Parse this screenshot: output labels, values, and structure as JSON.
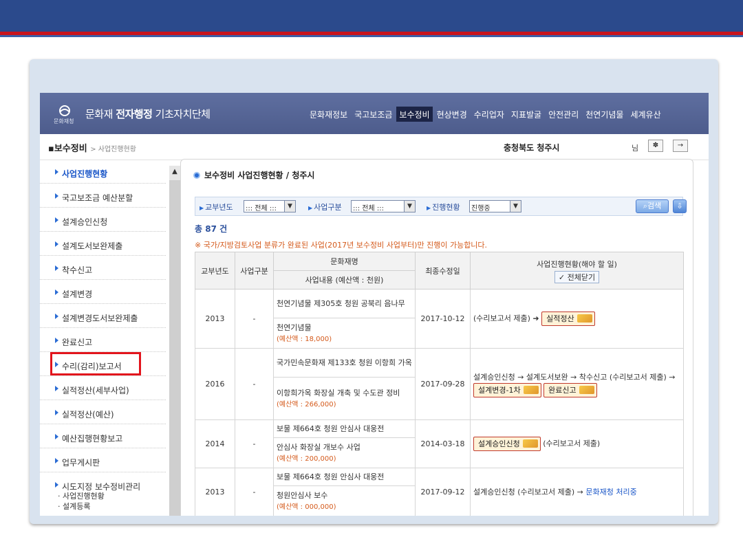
{
  "header": {
    "logo_text": "문화재청",
    "brand_prefix": "문화재",
    "brand_bold": "전자행정",
    "brand_suffix": "기초자치단체",
    "nav": [
      "문화재정보",
      "국고보조금",
      "보수정비",
      "현상변경",
      "수리업자",
      "지표발굴",
      "안전관리",
      "천연기념물",
      "세계유산"
    ],
    "active_nav": "보수정비"
  },
  "location": {
    "title": "보수정비",
    "sub": "> 사업진행현황",
    "org": "충청북도 청주시",
    "user_suffix": "님",
    "settings_icon": "gear-icon",
    "logout_icon": "logout-icon"
  },
  "sidebar": {
    "items": [
      "사업진행현황",
      "국고보조금 예산분할",
      "설계승인신청",
      "설계도서보완제출",
      "착수신고",
      "설계변경",
      "설계변경도서보완제출",
      "완료신고",
      "수리(감리)보고서",
      "실적정산(세부사업)",
      "실적정산(예산)",
      "예산집행현황보고",
      "업무게시판",
      "시도지정 보수정비관리"
    ],
    "sub_items": [
      "· 사업진행현황",
      "· 설계등록"
    ],
    "highlighted": "수리(감리)보고서"
  },
  "content": {
    "title": "보수정비 사업진행현황 / 청주시",
    "filters": {
      "year_label": "교부년도",
      "year_value": "::: 전체 :::",
      "type_label": "사업구분",
      "type_value": "::: 전체 :::",
      "status_label": "진행현황",
      "status_value": "진행중",
      "search_label": "검색"
    },
    "count": "총 87 건",
    "notice": "※ 국가/지방검토사업 분류가 완료된 사업(2017년 보수정비 사업부터)만 진행이 가능합니다.",
    "columns": {
      "year": "교부년도",
      "type": "사업구분",
      "name": "문화재명",
      "content": "사업내용 (예산액 : 천원)",
      "modified": "최종수정일",
      "progress": "사업진행현황(해야 할 일)",
      "close_all": "전체닫기"
    },
    "rows": [
      {
        "year": "2013",
        "type": "-",
        "name": "천연기념물 제305호 청원 공북리 음나무",
        "content": "천연기념물",
        "budget": "(예산액 : 18,000)",
        "modified": "2017-10-12",
        "progress_text": "(수리보고서 제출)",
        "buttons": [
          "실적정산"
        ]
      },
      {
        "year": "2016",
        "type": "-",
        "name": "국가민속문화재 제133호 청원 이항희 가옥",
        "content": "이항희가옥 화장실 개축 및 수도관 정비",
        "budget": "(예산액 : 266,000)",
        "modified": "2017-09-28",
        "progress_text": "설계승인신청 → 설계도서보완 → 착수신고 (수리보고서 제출) →",
        "buttons": [
          "설계변경-1차",
          "완료신고"
        ]
      },
      {
        "year": "2014",
        "type": "-",
        "name": "보물 제664호 청원 안심사 대웅전",
        "content": "안심사 화장실 개보수 사업",
        "budget": "(예산액 : 200,000)",
        "modified": "2014-03-18",
        "progress_text": "(수리보고서 제출)",
        "buttons": [
          "설계승인신청"
        ]
      },
      {
        "year": "2013",
        "type": "-",
        "name": "보물 제664호 청원 안심사 대웅전",
        "content": "청원안심사 보수",
        "budget": "(예산액 : 000,000)",
        "modified": "2017-09-12",
        "progress_text": "설계승인신청 (수리보고서 제출) →",
        "status_link": "문화재청 처리중",
        "buttons": []
      }
    ]
  }
}
